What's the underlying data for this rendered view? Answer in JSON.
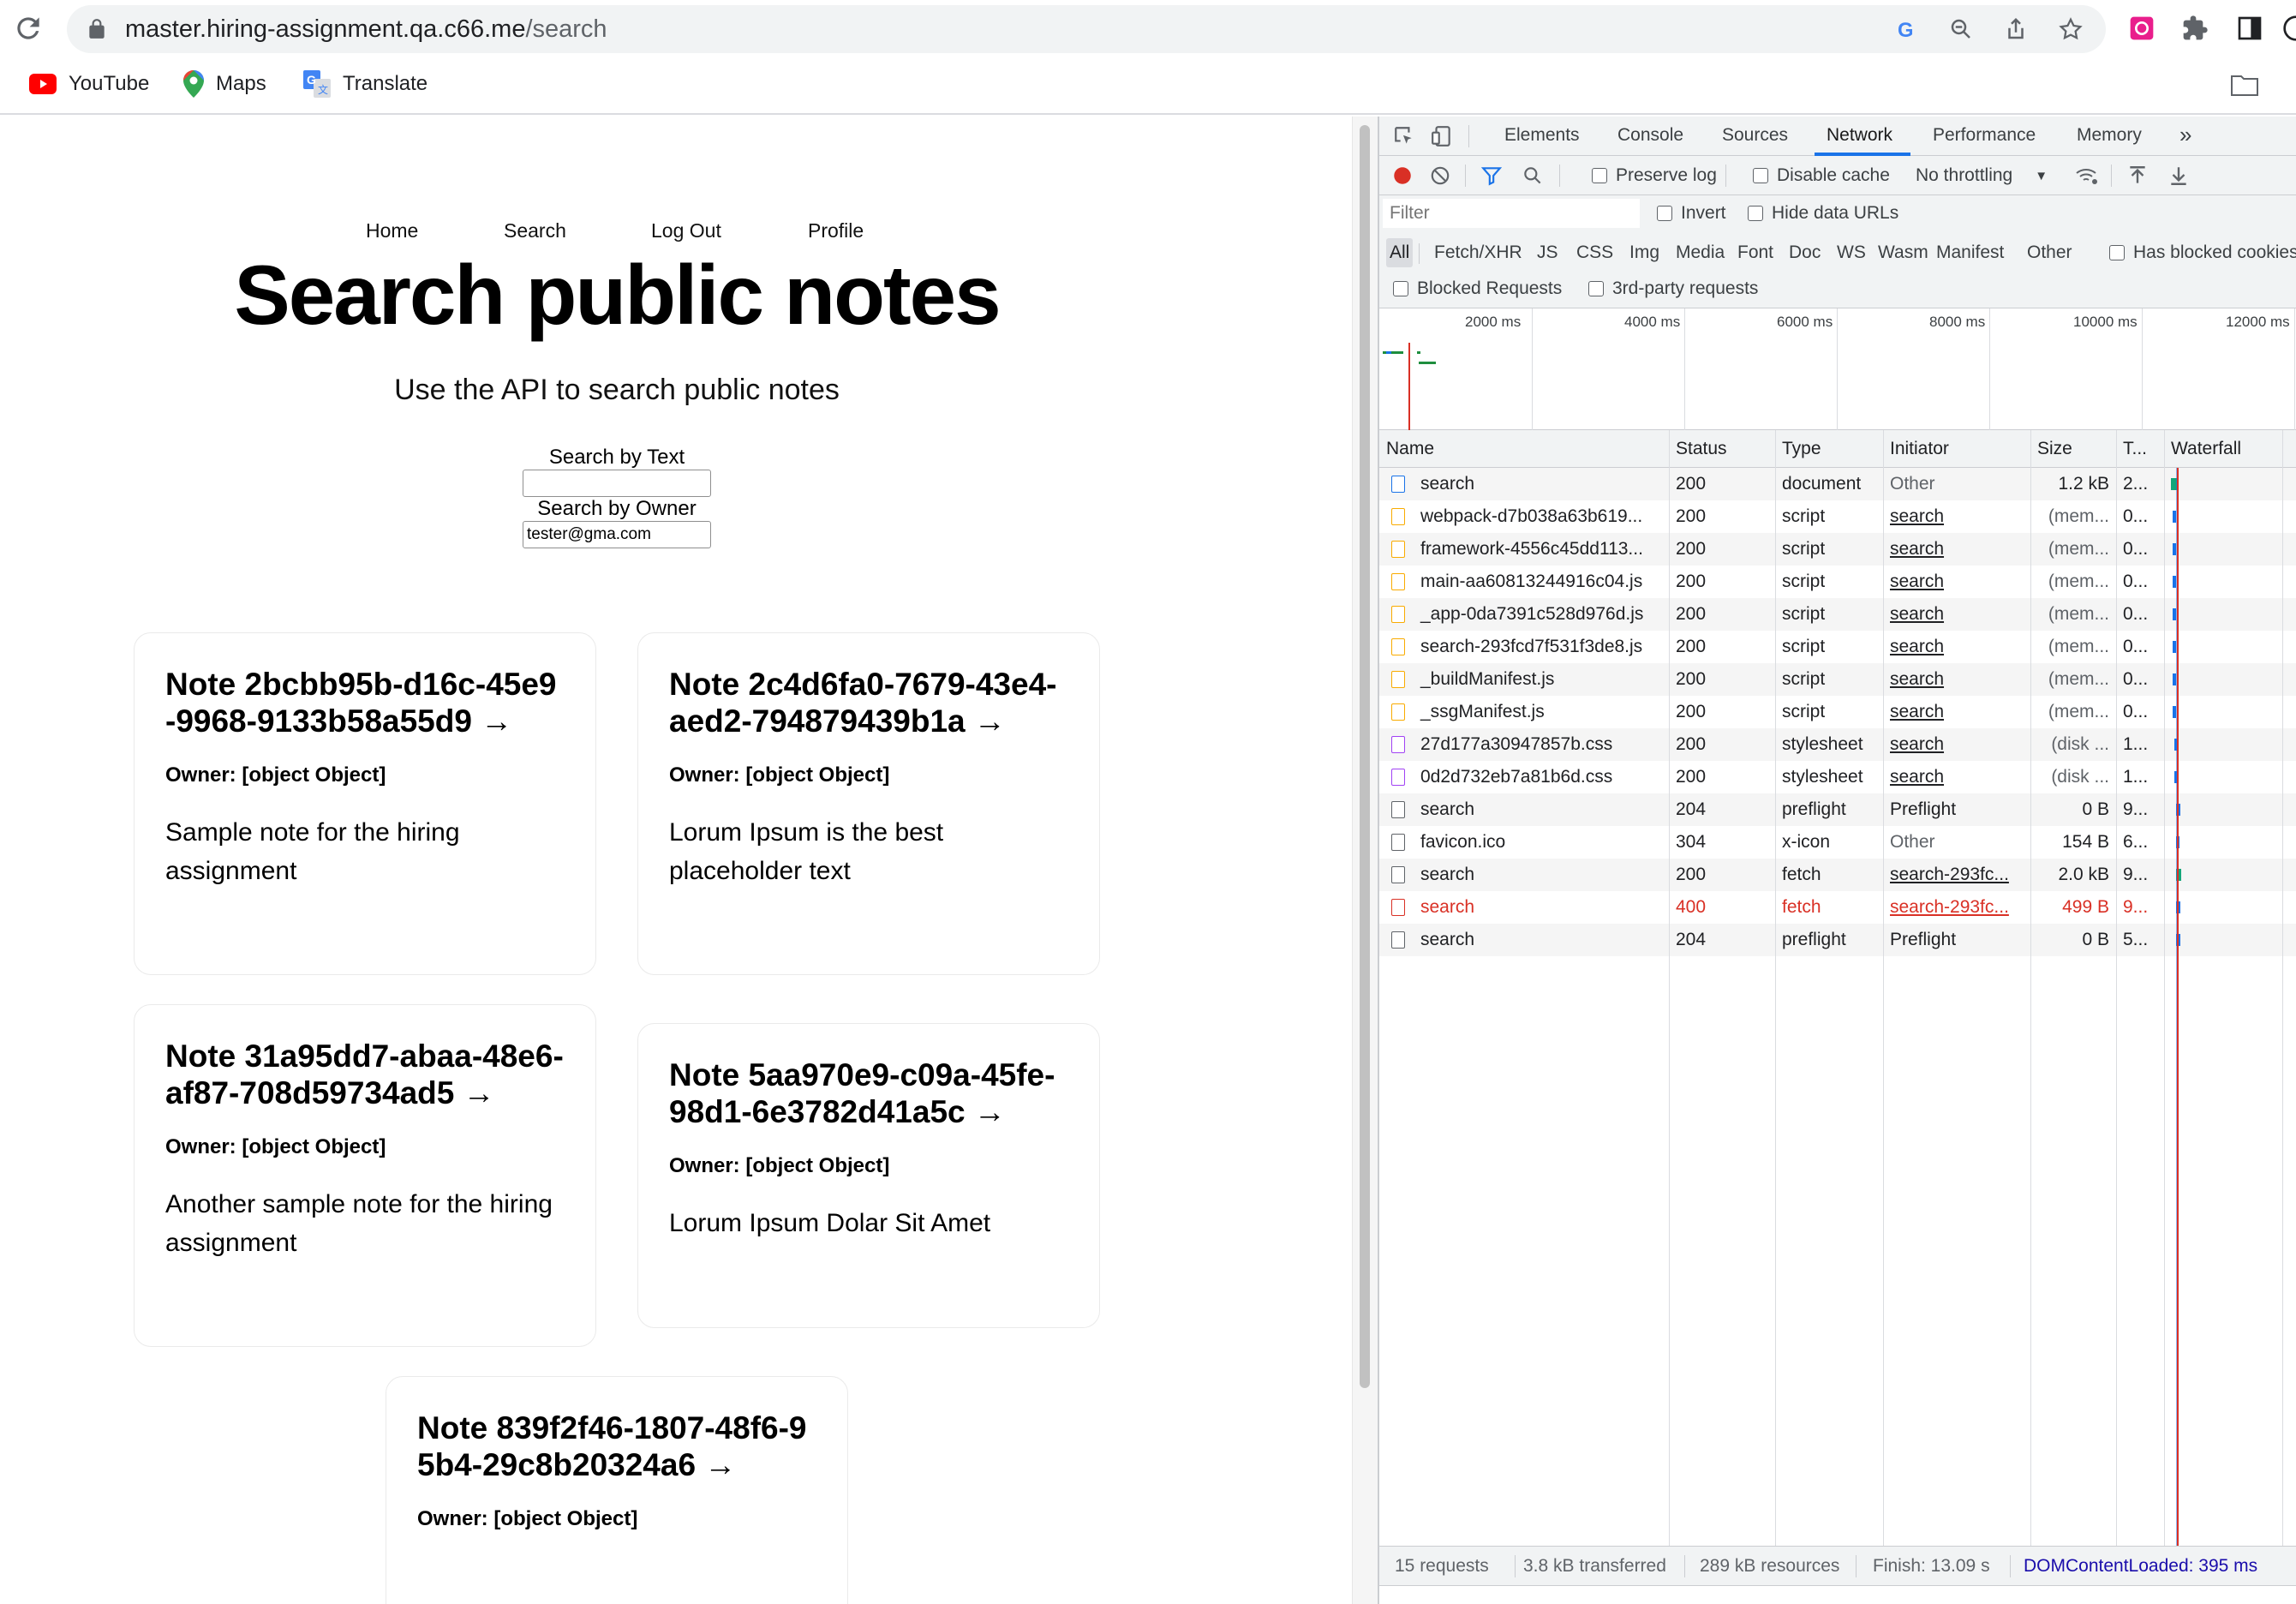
{
  "browser": {
    "url_host": "master.hiring-assignment.qa.c66.me",
    "url_path": "/search",
    "bookmarks": [
      {
        "label": "YouTube",
        "icon": "youtube-icon"
      },
      {
        "label": "Maps",
        "icon": "maps-pin-icon"
      },
      {
        "label": "Translate",
        "icon": "translate-icon"
      }
    ]
  },
  "page": {
    "nav": [
      "Home",
      "Search",
      "Log Out",
      "Profile"
    ],
    "title": "Search public notes",
    "subtitle": "Use the API to search public notes",
    "search_text_label": "Search by Text",
    "search_text_value": "",
    "search_owner_label": "Search by Owner",
    "search_owner_value": "tester@gma.com",
    "notes": [
      {
        "title": "Note 2bcbb95b-d16c-45e9-9968-9133b58a55d9 →",
        "owner": "Owner: [object Object]",
        "body": "Sample note for the hiring assignment"
      },
      {
        "title": "Note 2c4d6fa0-7679-43e4-aed2-794879439b1a →",
        "owner": "Owner: [object Object]",
        "body": "Lorum Ipsum is the best placeholder text"
      },
      {
        "title": "Note 31a95dd7-abaa-48e6-af87-708d59734ad5 →",
        "owner": "Owner: [object Object]",
        "body": "Another sample note for the hiring assignment"
      },
      {
        "title": "Note 5aa970e9-c09a-45fe-98d1-6e3782d41a5c →",
        "owner": "Owner: [object Object]",
        "body": "Lorum Ipsum Dolar Sit Amet"
      },
      {
        "title": "Note 839f2f46-1807-48f6-95b4-29c8b20324a6 →",
        "owner": "Owner: [object Object]",
        "body": ""
      }
    ]
  },
  "devtools": {
    "tabs": [
      "Elements",
      "Console",
      "Sources",
      "Network",
      "Performance",
      "Memory"
    ],
    "active_tab": "Network",
    "more_tabs": "»",
    "toolbar": {
      "preserve_log": "Preserve log",
      "disable_cache": "Disable cache",
      "throttling": "No throttling"
    },
    "filter": {
      "placeholder": "Filter",
      "invert": "Invert",
      "hide_data_urls": "Hide data URLs",
      "types": [
        "All",
        "Fetch/XHR",
        "JS",
        "CSS",
        "Img",
        "Media",
        "Font",
        "Doc",
        "WS",
        "Wasm",
        "Manifest",
        "Other"
      ],
      "active_type": "All",
      "has_blocked_cookies": "Has blocked cookies",
      "blocked_requests": "Blocked Requests",
      "third_party": "3rd-party requests"
    },
    "overview_ticks": [
      "2000 ms",
      "4000 ms",
      "6000 ms",
      "8000 ms",
      "10000 ms",
      "12000 ms"
    ],
    "columns": [
      "Name",
      "Status",
      "Type",
      "Initiator",
      "Size",
      "T...",
      "Waterfall"
    ],
    "requests": [
      {
        "name": "search",
        "status": "200",
        "type": "document",
        "initiator": "Other",
        "initiator_link": false,
        "size": "1.2 kB",
        "time": "2...",
        "icon": "document",
        "color": "#1a73e8"
      },
      {
        "name": "webpack-d7b038a63b619...",
        "status": "200",
        "type": "script",
        "initiator": "search",
        "initiator_link": true,
        "size": "(mem...",
        "time": "0...",
        "icon": "script",
        "color": "#f9ab00"
      },
      {
        "name": "framework-4556c45dd113...",
        "status": "200",
        "type": "script",
        "initiator": "search",
        "initiator_link": true,
        "size": "(mem...",
        "time": "0...",
        "icon": "script",
        "color": "#f9ab00"
      },
      {
        "name": "main-aa60813244916c04.js",
        "status": "200",
        "type": "script",
        "initiator": "search",
        "initiator_link": true,
        "size": "(mem...",
        "time": "0...",
        "icon": "script",
        "color": "#f9ab00"
      },
      {
        "name": "_app-0da7391c528d976d.js",
        "status": "200",
        "type": "script",
        "initiator": "search",
        "initiator_link": true,
        "size": "(mem...",
        "time": "0...",
        "icon": "script",
        "color": "#f9ab00"
      },
      {
        "name": "search-293fcd7f531f3de8.js",
        "status": "200",
        "type": "script",
        "initiator": "search",
        "initiator_link": true,
        "size": "(mem...",
        "time": "0...",
        "icon": "script",
        "color": "#f9ab00"
      },
      {
        "name": "_buildManifest.js",
        "status": "200",
        "type": "script",
        "initiator": "search",
        "initiator_link": true,
        "size": "(mem...",
        "time": "0...",
        "icon": "script",
        "color": "#f9ab00"
      },
      {
        "name": "_ssgManifest.js",
        "status": "200",
        "type": "script",
        "initiator": "search",
        "initiator_link": true,
        "size": "(mem...",
        "time": "0...",
        "icon": "script",
        "color": "#f9ab00"
      },
      {
        "name": "27d177a30947857b.css",
        "status": "200",
        "type": "stylesheet",
        "initiator": "search",
        "initiator_link": true,
        "size": "(disk ...",
        "time": "1...",
        "icon": "stylesheet",
        "color": "#a142f4"
      },
      {
        "name": "0d2d732eb7a81b6d.css",
        "status": "200",
        "type": "stylesheet",
        "initiator": "search",
        "initiator_link": true,
        "size": "(disk ...",
        "time": "1...",
        "icon": "stylesheet",
        "color": "#a142f4"
      },
      {
        "name": "search",
        "status": "204",
        "type": "preflight",
        "initiator": "Preflight",
        "initiator_link": false,
        "size": "0 B",
        "time": "9...",
        "icon": "other",
        "color": "#5f6368"
      },
      {
        "name": "favicon.ico",
        "status": "304",
        "type": "x-icon",
        "initiator": "Other",
        "initiator_link": false,
        "size": "154 B",
        "time": "6...",
        "icon": "other",
        "color": "#5f6368"
      },
      {
        "name": "search",
        "status": "200",
        "type": "fetch",
        "initiator": "search-293fc...",
        "initiator_link": true,
        "size": "2.0 kB",
        "time": "9...",
        "icon": "other",
        "color": "#5f6368"
      },
      {
        "name": "search",
        "status": "400",
        "type": "fetch",
        "initiator": "search-293fc...",
        "initiator_link": true,
        "size": "499 B",
        "time": "9...",
        "icon": "error",
        "color": "#d93025",
        "error": true
      },
      {
        "name": "search",
        "status": "204",
        "type": "preflight",
        "initiator": "Preflight",
        "initiator_link": false,
        "size": "0 B",
        "time": "5...",
        "icon": "other",
        "color": "#5f6368"
      }
    ],
    "status_bar": {
      "requests": "15 requests",
      "transferred": "3.8 kB transferred",
      "resources": "289 kB resources",
      "finish": "Finish: 13.09 s",
      "dom_content_loaded": "DOMContentLoaded: 395 ms"
    }
  }
}
